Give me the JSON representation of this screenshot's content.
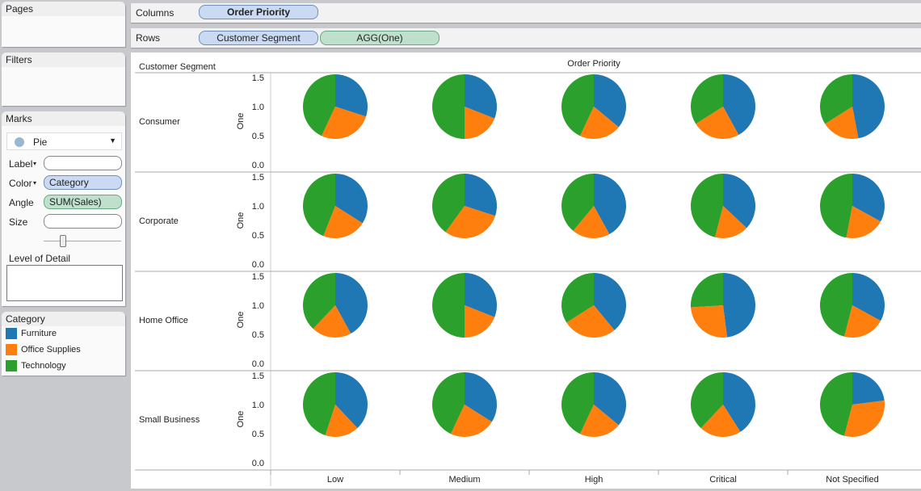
{
  "left": {
    "pages": "Pages",
    "filters": "Filters",
    "marks": "Marks",
    "mark_type": "Pie",
    "label": "Label",
    "color": "Color",
    "color_field": "Category",
    "angle": "Angle",
    "angle_field": "SUM(Sales)",
    "size": "Size",
    "size_slider": 0.3,
    "lod": "Level of Detail",
    "legend_title": "Category",
    "legend": [
      {
        "label": "Furniture",
        "color": "#1f77b4"
      },
      {
        "label": "Office Supplies",
        "color": "#ff7f0e"
      },
      {
        "label": "Technology",
        "color": "#2ca02c"
      }
    ]
  },
  "shelves": {
    "columns": "Columns",
    "columns_pills": [
      "Order Priority"
    ],
    "rows": "Rows",
    "rows_pills": [
      "Customer Segment",
      "AGG(One)"
    ]
  },
  "chart_data": {
    "type": "pie",
    "row_header": "Customer Segment",
    "col_header": "Order Priority",
    "rows": [
      "Consumer",
      "Corporate",
      "Home Office",
      "Small Business"
    ],
    "columns": [
      "Low",
      "Medium",
      "High",
      "Critical",
      "Not Specified"
    ],
    "ylabel": "One",
    "ylim": [
      0,
      1.5
    ],
    "yticks": [
      "1.5",
      "1.0",
      "0.5",
      "0.0"
    ],
    "pie_y": 1.0,
    "slices": [
      "Furniture",
      "Office Supplies",
      "Technology"
    ],
    "colors": [
      "#1f77b4",
      "#ff7f0e",
      "#2ca02c"
    ],
    "shares": [
      [
        [
          0.3,
          0.27,
          0.43
        ],
        [
          0.31,
          0.19,
          0.5
        ],
        [
          0.36,
          0.21,
          0.43
        ],
        [
          0.42,
          0.24,
          0.34
        ],
        [
          0.47,
          0.19,
          0.34
        ]
      ],
      [
        [
          0.34,
          0.22,
          0.44
        ],
        [
          0.3,
          0.3,
          0.4
        ],
        [
          0.42,
          0.19,
          0.39
        ],
        [
          0.37,
          0.17,
          0.46
        ],
        [
          0.33,
          0.2,
          0.47
        ]
      ],
      [
        [
          0.42,
          0.2,
          0.38
        ],
        [
          0.31,
          0.19,
          0.5
        ],
        [
          0.39,
          0.27,
          0.34
        ],
        [
          0.48,
          0.26,
          0.26
        ],
        [
          0.33,
          0.21,
          0.46
        ]
      ],
      [
        [
          0.38,
          0.17,
          0.45
        ],
        [
          0.34,
          0.23,
          0.43
        ],
        [
          0.36,
          0.21,
          0.43
        ],
        [
          0.41,
          0.21,
          0.38
        ],
        [
          0.23,
          0.31,
          0.46
        ]
      ]
    ]
  }
}
